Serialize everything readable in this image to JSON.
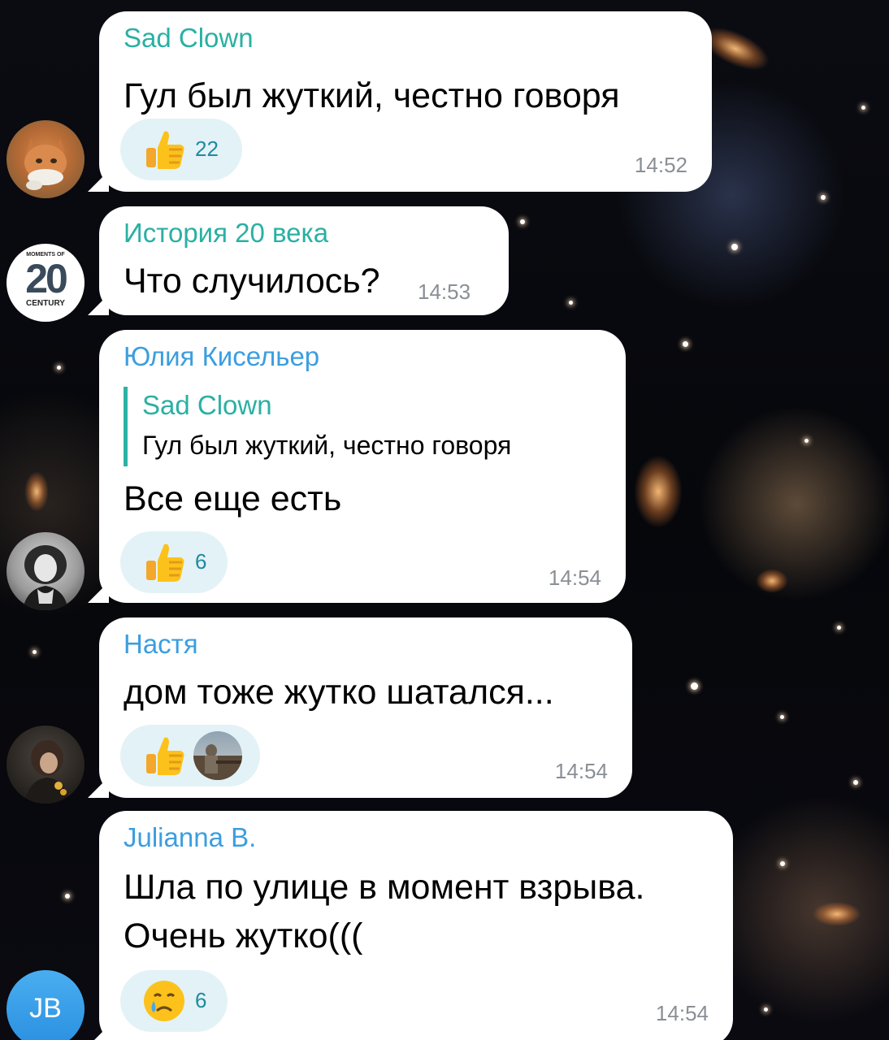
{
  "colors": {
    "sad_clown": "#2ab0a3",
    "istoriya": "#2ab0a3",
    "yulia": "#3b9ee0",
    "nastya": "#3b9ee0",
    "julianna": "#3b9ee0",
    "jb_avatar": "#2e9be6",
    "reaction_bg": "#e3f2f6",
    "reaction_count": "#1f8aa0",
    "time": "#8a8f95"
  },
  "messages": [
    {
      "sender": "Sad Clown",
      "text": "Гул был жуткий, честно говоря",
      "time": "14:52",
      "reaction": {
        "emoji": "thumbs-up",
        "count": "22"
      },
      "avatar": "cat-photo"
    },
    {
      "sender": "История 20 века",
      "text": "Что случилось?",
      "time": "14:53",
      "avatar": "moments-of-20-century-logo",
      "avatar_small_top": "MOMENTS OF",
      "avatar_big": "20",
      "avatar_small_bottom": "CENTURY"
    },
    {
      "sender": "Юлия Кисельер",
      "quote": {
        "sender": "Sad Clown",
        "text": "Гул был жуткий, честно говоря"
      },
      "text": "Все еще есть",
      "time": "14:54",
      "reaction": {
        "emoji": "thumbs-up",
        "count": "6"
      },
      "avatar": "woman-bw-photo"
    },
    {
      "sender": "Настя",
      "text": "дом тоже жутко шатался...",
      "time": "14:54",
      "reaction": {
        "emoji": "thumbs-up",
        "reactor_avatar": "person-photo"
      },
      "avatar": "girl-photo"
    },
    {
      "sender": "Julianna B.",
      "text_line1": "Шла по улице в момент взрыва.",
      "text_line2": "Очень жутко(((",
      "time": "14:54",
      "reaction": {
        "emoji": "crying-face",
        "count": "6"
      },
      "avatar_initials": "JB"
    }
  ]
}
